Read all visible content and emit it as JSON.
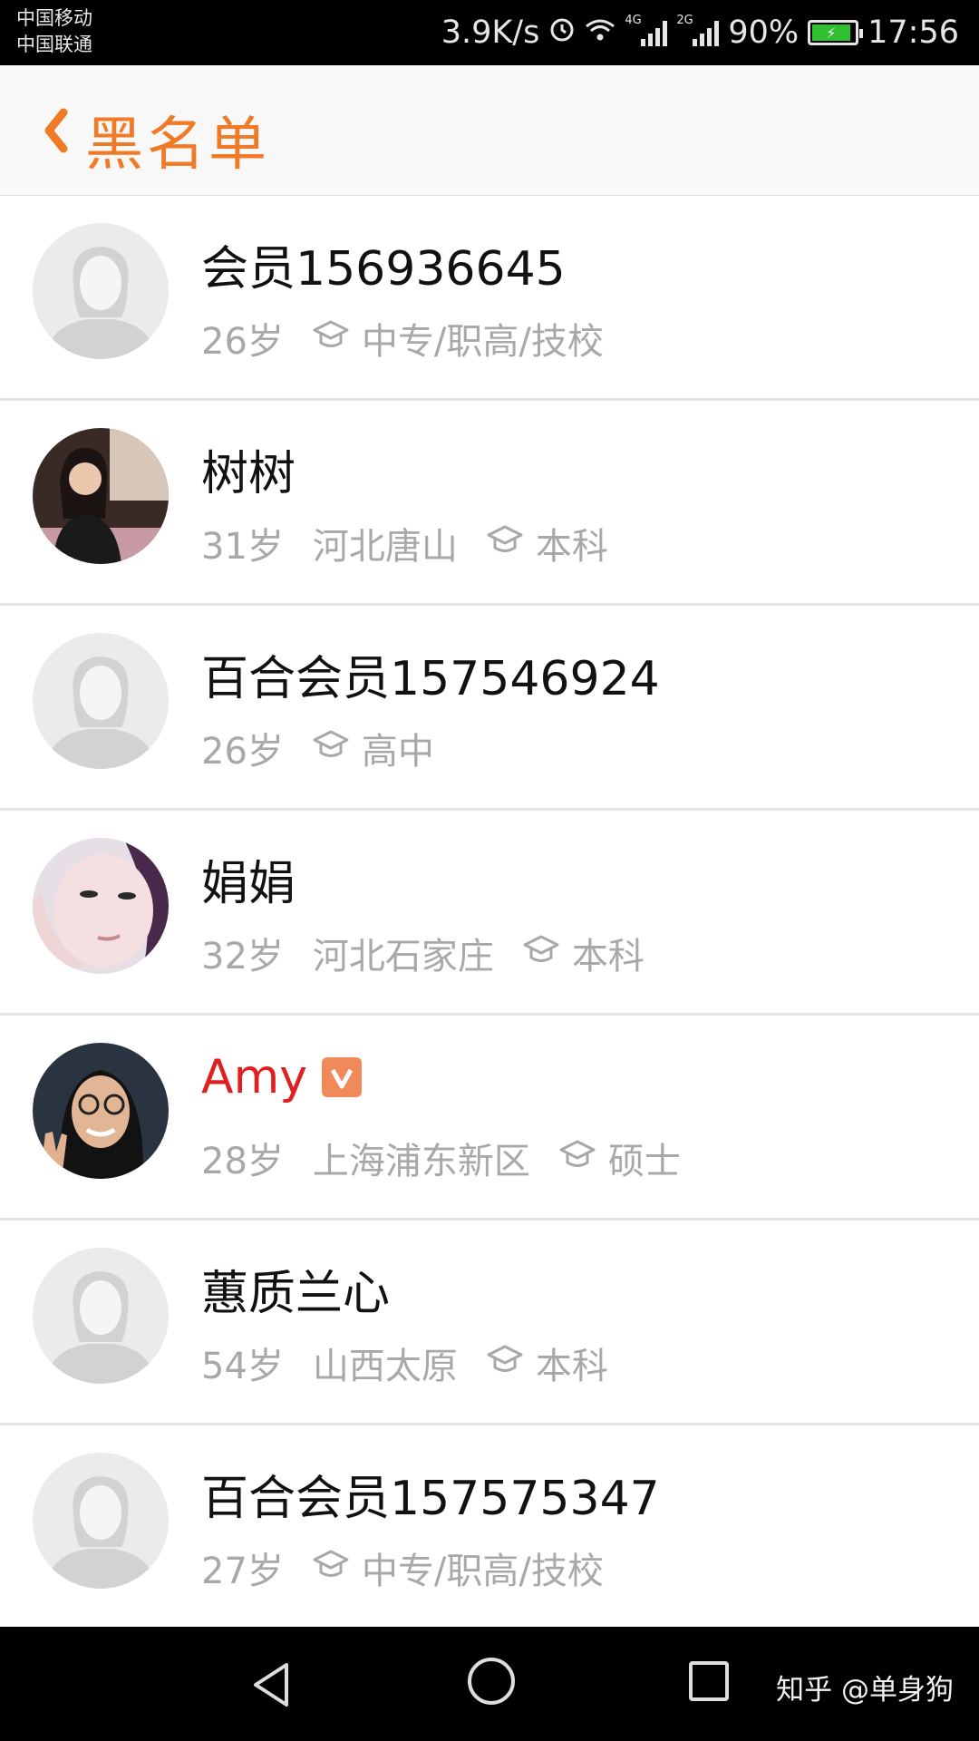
{
  "status": {
    "carrier1": "中国移动",
    "carrier2": "中国联通",
    "speed": "3.9K/s",
    "net1": "4G",
    "net2": "2G",
    "battery": "90%",
    "time": "17:56"
  },
  "header": {
    "title": "黑名单"
  },
  "rows": [
    {
      "name": "会员156936645",
      "age": "26岁",
      "location": "",
      "education": "中专/职高/技校",
      "avatar": "placeholder"
    },
    {
      "name": "树树",
      "age": "31岁",
      "location": "河北唐山",
      "education": "本科",
      "avatar": "photo-1"
    },
    {
      "name": "百合会员157546924",
      "age": "26岁",
      "location": "",
      "education": "高中",
      "avatar": "placeholder"
    },
    {
      "name": "娟娟",
      "age": "32岁",
      "location": "河北石家庄",
      "education": "本科",
      "avatar": "photo-2"
    },
    {
      "name": "Amy",
      "age": "28岁",
      "location": "上海浦东新区",
      "education": "硕士",
      "avatar": "photo-3",
      "vip": true
    },
    {
      "name": "蕙质兰心",
      "age": "54岁",
      "location": "山西太原",
      "education": "本科",
      "avatar": "placeholder"
    },
    {
      "name": "百合会员157575347",
      "age": "27岁",
      "location": "",
      "education": "中专/职高/技校",
      "avatar": "placeholder"
    }
  ],
  "watermark": "知乎 @单身狗",
  "colors": {
    "accent": "#f07a26",
    "vip_name": "#e02020",
    "meta": "#a8a8a8"
  }
}
